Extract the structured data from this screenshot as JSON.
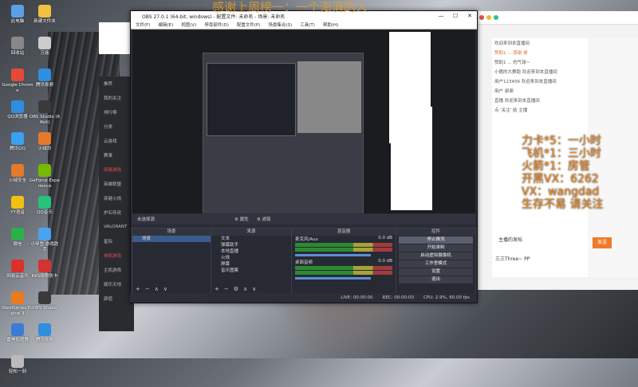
{
  "overlay": {
    "top_text": "感谢上周榜一：一个澎湃的人",
    "right_lines": [
      "力卡*5：一小时",
      "飞机*1：三小时",
      "火箭*1：房管",
      "开黑VX：6262",
      "VX：wangdad",
      "生存不易 请关注"
    ]
  },
  "desktop_icons_left": [
    {
      "label": "此电脑",
      "color": "#5aa0e6"
    },
    {
      "label": "回收站",
      "color": "#888888"
    },
    {
      "label": "Google Chrome",
      "color": "#e5493a"
    },
    {
      "label": "QQ浏览器",
      "color": "#2f8ee0"
    },
    {
      "label": "腾讯QQ",
      "color": "#3aa0f0"
    },
    {
      "label": "火绒安全",
      "color": "#e57a2a"
    },
    {
      "label": "YY语音",
      "color": "#f2c012"
    },
    {
      "label": "微信",
      "color": "#29b14a"
    },
    {
      "label": "网易云音乐",
      "color": "#d9322b"
    },
    {
      "label": "SteelSeries Engine 3",
      "color": "#ea7a1f"
    },
    {
      "label": "雷神加速器",
      "color": "#3a7bd5"
    },
    {
      "label": "轻松一刻",
      "color": "#bbbbbb"
    }
  ],
  "desktop_icons_col2": [
    {
      "label": "新建文件夹",
      "color": "#f0c040"
    },
    {
      "label": "万能",
      "color": "#cccccc"
    },
    {
      "label": "腾讯视频",
      "color": "#2f8ee0"
    },
    {
      "label": "OBS Studio (64bit)",
      "color": "#3a3a3a"
    },
    {
      "label": "火绒剑",
      "color": "#e57a2a"
    },
    {
      "label": "GeForce Experience",
      "color": "#76b900"
    },
    {
      "label": "QQ音乐",
      "color": "#27c27b"
    },
    {
      "label": "小甲鱼 游戏助手",
      "color": "#4aa3f0"
    },
    {
      "label": "KKS极限防卡",
      "color": "#d33333"
    },
    {
      "label": "OBS Studio",
      "color": "#3a3a3a"
    },
    {
      "label": "腾讯视频",
      "color": "#2f8ee0"
    }
  ],
  "app_sidebar": {
    "items": [
      {
        "label": "推荐",
        "red": false
      },
      {
        "label": "我的关注",
        "red": false
      },
      {
        "label": "排行榜",
        "red": false
      },
      {
        "label": "分类",
        "red": false
      },
      {
        "label": "云游戏",
        "red": false
      },
      {
        "label": "赛事",
        "red": false
      },
      {
        "label": "网易游戏",
        "red": true
      },
      {
        "label": "英雄联盟",
        "red": false
      },
      {
        "label": "穿越火线",
        "red": false
      },
      {
        "label": "炉石传说",
        "red": false
      },
      {
        "label": "VALORANT",
        "red": false
      },
      {
        "label": "星际",
        "red": false
      },
      {
        "label": "单机游戏",
        "red": true
      },
      {
        "label": "主机游戏",
        "red": false
      },
      {
        "label": "娱乐天地",
        "red": false
      },
      {
        "label": "颜值",
        "red": false
      }
    ]
  },
  "obs": {
    "title": "OBS 27.0.1 (64-bit, windows) - 配置文件: 未命名 - 场景: 未命名",
    "menu": [
      "文件(F)",
      "编辑(E)",
      "视图(V)",
      "停靠部件(D)",
      "配置文件(P)",
      "场景集合(S)",
      "工具(T)",
      "帮助(H)"
    ],
    "window_controls": [
      "—",
      "☐",
      "✕"
    ],
    "no_source": "未选择源",
    "props_btn": "属性",
    "filters_btn": "滤镜",
    "docks": {
      "scenes": {
        "header": "场景",
        "items": [
          "场景"
        ]
      },
      "sources": {
        "header": "来源",
        "items": [
          "文本",
          "弹幕助手",
          "本地直播",
          "火线",
          "屏幕",
          "音乐图案"
        ]
      },
      "mixer": {
        "header": "混音器",
        "channels": [
          {
            "name": "麦克风/Aux",
            "db": "0.0 dB"
          },
          {
            "name": "桌面音频",
            "db": "0.0 dB"
          }
        ]
      },
      "controls": {
        "header": "控件",
        "buttons": [
          "停止推流",
          "开始录制",
          "启动虚拟摄像机",
          "工作室模式",
          "设置",
          "退出"
        ]
      }
    },
    "status": {
      "live": "LIVE: 00:00:00",
      "rec": "REC: 00:00:00",
      "cpu": "CPU: 2.9%, 60.00 fps"
    }
  },
  "browser": {
    "chat_lines": [
      {
        "text": "欢迎来到本直播间",
        "hl": false
      },
      {
        "text": "赞助1 ... 感谢 谢",
        "hl": true
      },
      {
        "text": "赞助1 ... 的气球~",
        "hl": false
      },
      {
        "text": "小猪的大赛跑 欢迎来到本直播间",
        "hl": false
      },
      {
        "text": "用户123456 欢迎来到本直播间",
        "hl": false
      },
      {
        "text": "用户 谢谢",
        "hl": false
      },
      {
        "text": "直播 欢迎来到本直播间",
        "hl": false
      },
      {
        "text": "点 '关注'  给 主播",
        "hl": false
      }
    ],
    "send_label": "发送",
    "side_title": "主播的发帖",
    "side_line": "三三Three~ PP"
  }
}
